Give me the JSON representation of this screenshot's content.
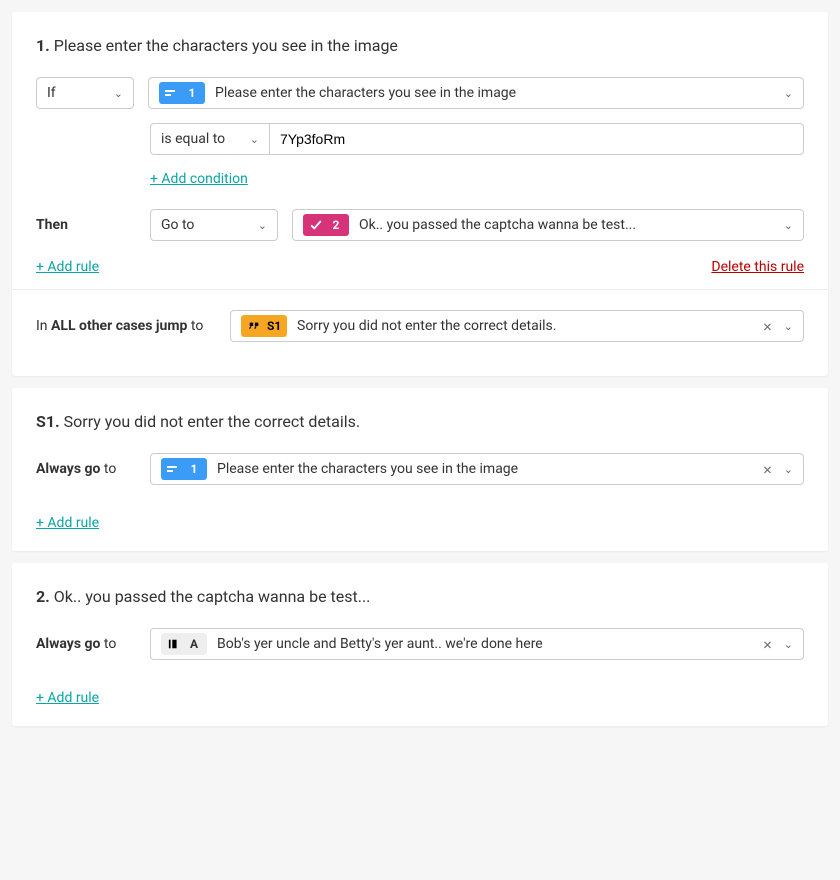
{
  "panel1": {
    "title_num": "1.",
    "title_text": "Please enter the characters you see in the image",
    "if_label": "If",
    "if_question_badge": "1",
    "if_question_text": "Please enter the characters you see in the image",
    "op_label": "is equal to",
    "op_value": "7Yp3foRm",
    "add_condition": "+ Add condition",
    "then_label": "Then",
    "goto_label": "Go to",
    "goto_badge": "2",
    "goto_text": "Ok.. you passed the captcha wanna be test...",
    "add_rule": "+ Add rule",
    "delete_rule": "Delete this rule",
    "else_pre": "In ",
    "else_bold": "ALL other cases jump",
    "else_post": " to",
    "else_badge": "S1",
    "else_text": "Sorry you did not enter the correct details."
  },
  "panel2": {
    "title_num": "S1.",
    "title_text": "Sorry you did not enter the correct details.",
    "always_bold": "Always go",
    "always_sub": " to",
    "dest_badge": "1",
    "dest_text": "Please enter the characters you see in the image",
    "add_rule": "+ Add rule"
  },
  "panel3": {
    "title_num": "2.",
    "title_text": "Ok.. you passed the captcha wanna be test...",
    "always_bold": "Always go",
    "always_sub": " to",
    "dest_badge": "A",
    "dest_text": "Bob's yer uncle and Betty's yer aunt.. we're done here",
    "add_rule": "+ Add rule"
  }
}
